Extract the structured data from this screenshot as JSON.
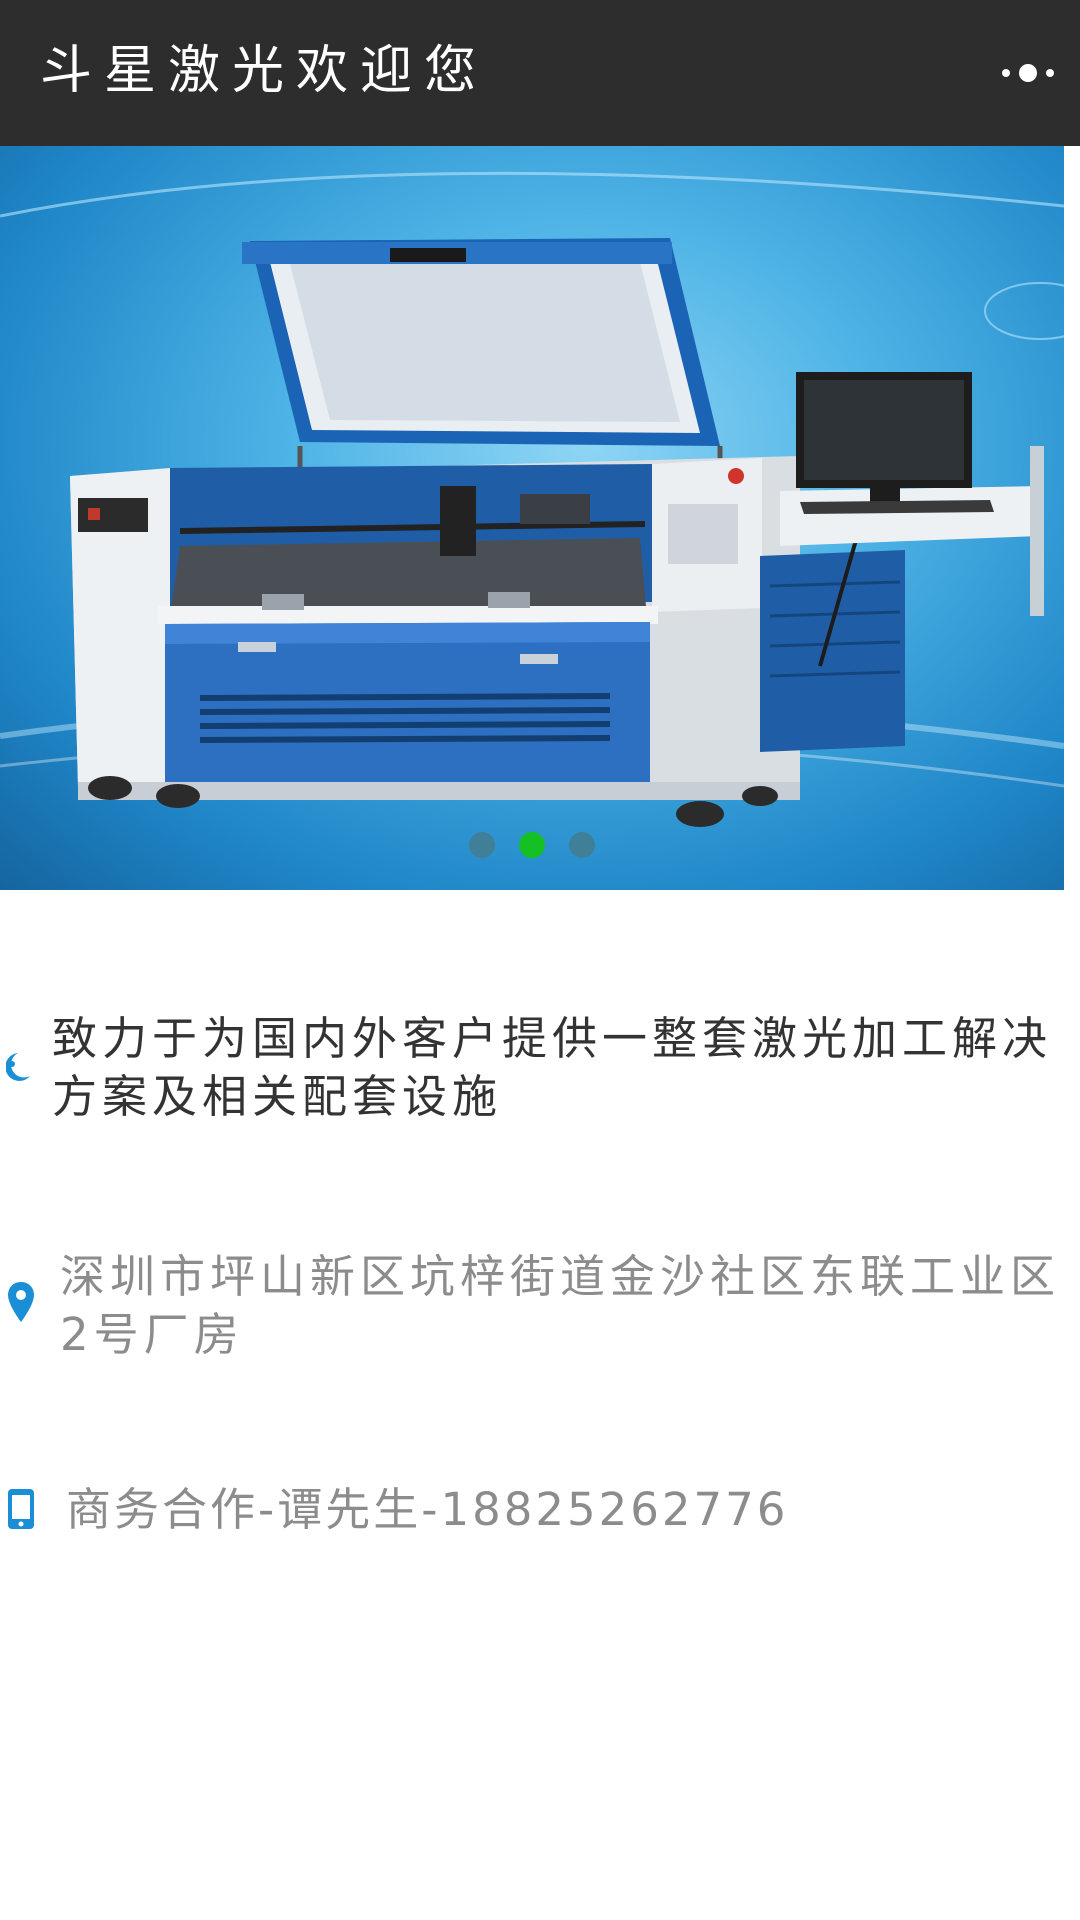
{
  "header": {
    "title": "斗星激光欢迎您",
    "menu_icon": "more-dots-icon"
  },
  "banner": {
    "image": "laser-cutting-machine",
    "slide_count": 3,
    "active_slide": 2
  },
  "info": {
    "slogan": {
      "icon": "moon-icon",
      "text": "致力于为国内外客户提供一整套激光加工解决方案及相关配套设施"
    },
    "address": {
      "icon": "location-pin-icon",
      "text": "深圳市坪山新区坑梓街道金沙社区东联工业区2号厂房"
    },
    "contact": {
      "icon": "mobile-phone-icon",
      "text": "商务合作-谭先生-18825262776"
    }
  },
  "colors": {
    "header_bg": "#2d2d2d",
    "accent_blue": "#1a8fd6",
    "active_dot": "#14c023",
    "inactive_dot": "#3f7f98",
    "muted_text": "#8c8c8c"
  }
}
